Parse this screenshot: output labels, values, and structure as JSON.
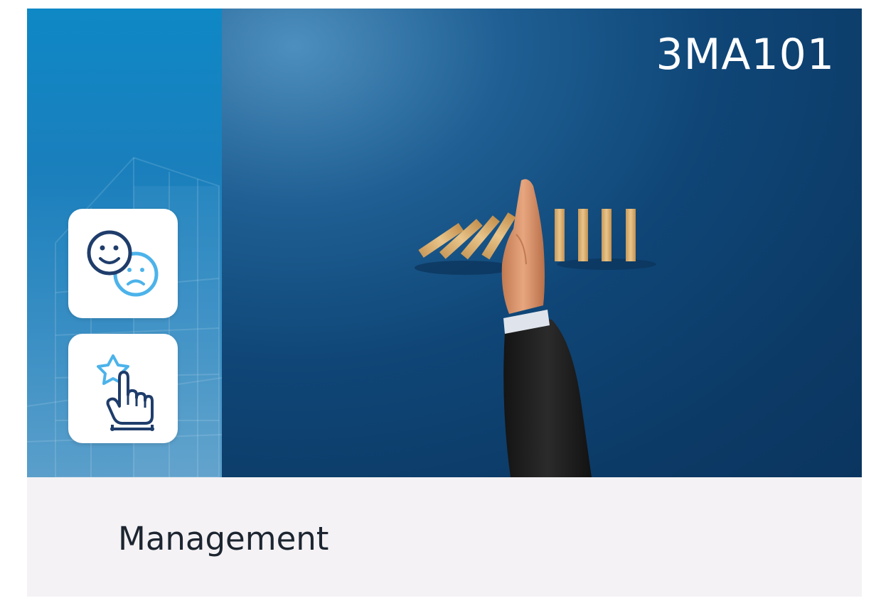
{
  "card": {
    "code": "3MA101",
    "title": "Management"
  },
  "icons": {
    "feedback": "smiley-frowny-feedback-icon",
    "rating": "star-hand-pointer-icon"
  },
  "colors": {
    "hero_background": "#0f4677",
    "side_panel": "#1a7fbc",
    "footer_background": "#f4f2f4",
    "icon_dark": "#1f3d6b",
    "icon_light": "#4cb3ea",
    "title_text": "#1c2530",
    "code_text": "#ffffff"
  }
}
